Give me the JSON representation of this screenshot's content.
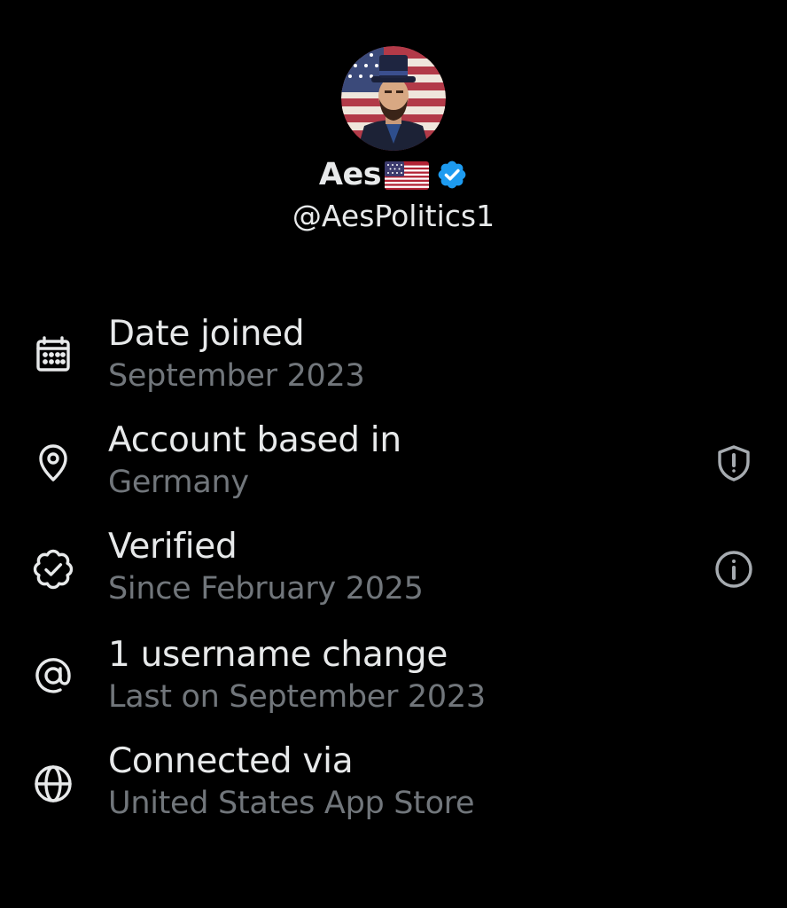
{
  "profile": {
    "display_name": "Aes",
    "handle": "@AesPolitics1",
    "flag_icon": "us-flag-icon",
    "verified_icon": "verified-badge-icon",
    "verified_color": "#1d9bf0"
  },
  "details": [
    {
      "icon": "calendar-icon",
      "title": "Date joined",
      "subtitle": "September 2023"
    },
    {
      "icon": "location-pin-icon",
      "title": "Account based in",
      "subtitle": "Germany",
      "action_icon": "shield-alert-icon"
    },
    {
      "icon": "verified-outline-icon",
      "title": "Verified",
      "subtitle": "Since February 2025",
      "action_icon": "info-icon"
    },
    {
      "icon": "at-sign-icon",
      "title": "1 username change",
      "subtitle": "Last on September 2023"
    },
    {
      "icon": "globe-icon",
      "title": "Connected via",
      "subtitle": "United States App Store"
    }
  ],
  "colors": {
    "background": "#000000",
    "primary_text": "#e7e9ea",
    "secondary_text": "#71767b",
    "icon": "#e7e9ea",
    "action_icon": "#a6abb0"
  }
}
